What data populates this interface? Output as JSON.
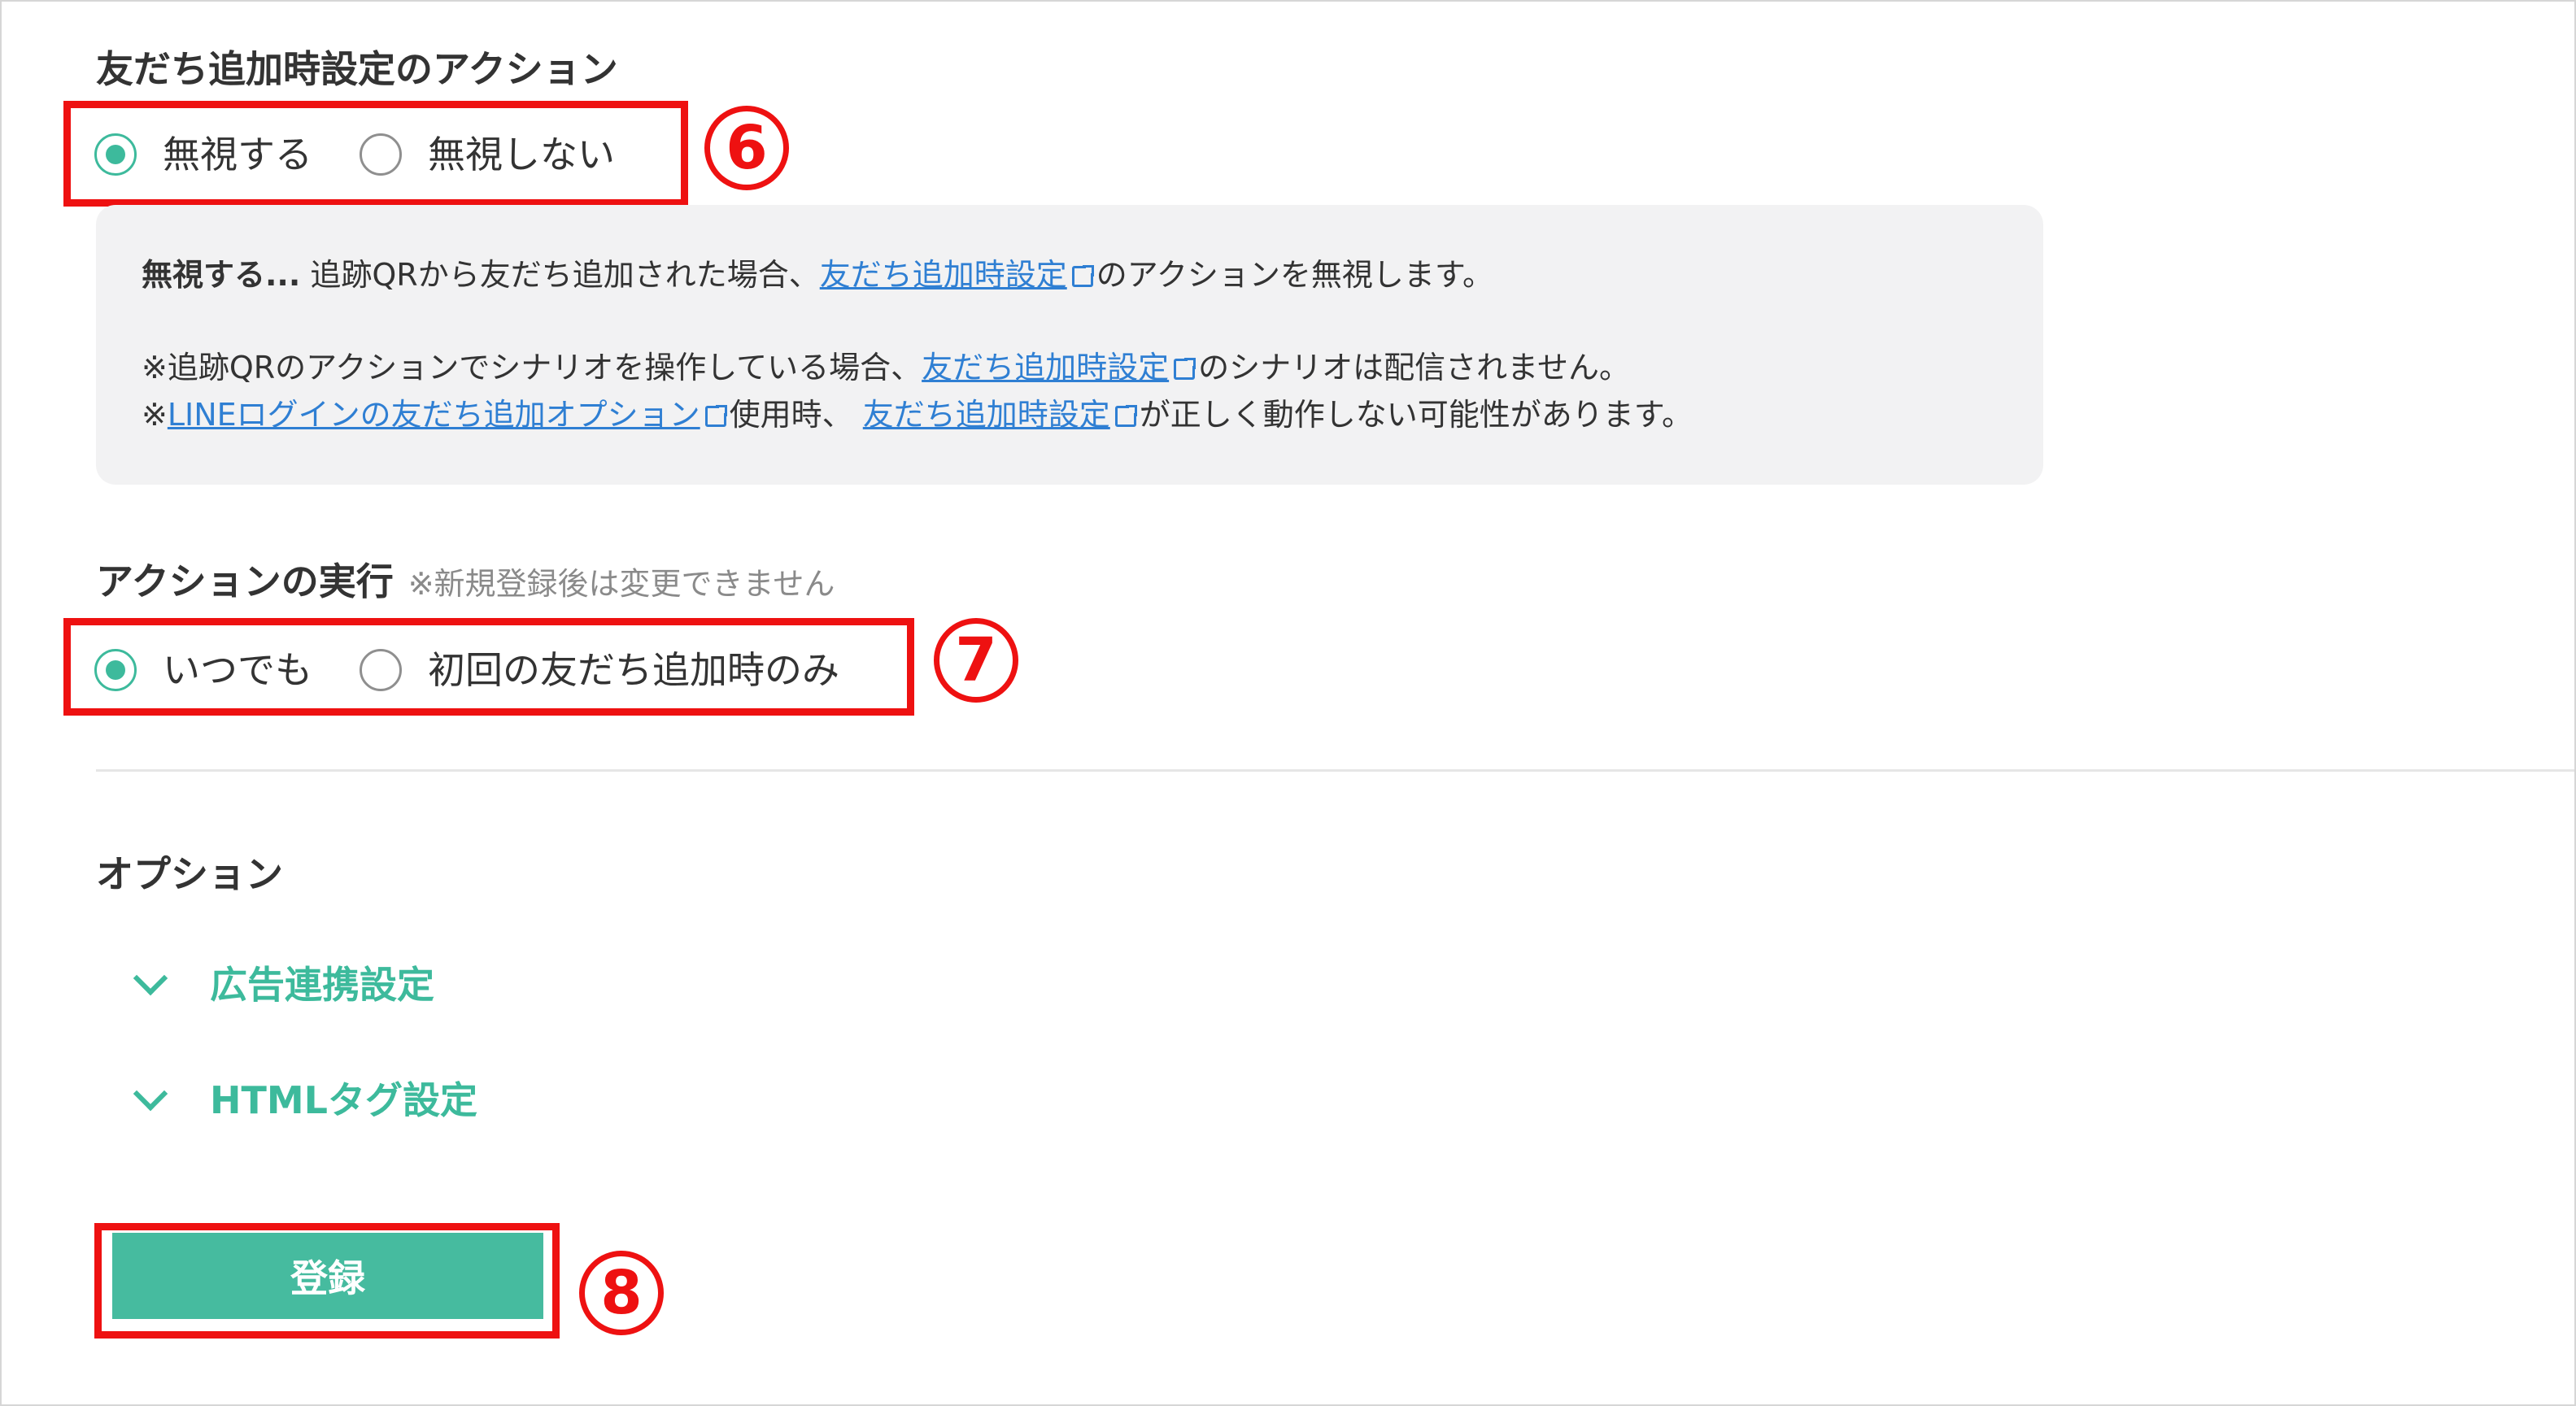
{
  "friend_add_action": {
    "title": "友だち追加時設定のアクション",
    "options": [
      {
        "label": "無視する",
        "checked": true
      },
      {
        "label": "無視しない",
        "checked": false
      }
    ],
    "annotation_number": "6"
  },
  "info": {
    "line1_bold": "無視する...",
    "line1_text_a": " 追跡QRから友だち追加された場合、",
    "line1_link": "友だち追加時設定",
    "line1_text_b": "のアクションを無視します。",
    "line2_text_a": "※追跡QRのアクションでシナリオを操作している場合、",
    "line2_link": "友だち追加時設定",
    "line2_text_b": "のシナリオは配信されません。",
    "line3_text_a": "※",
    "line3_link_a": "LINEログインの友だち追加オプション",
    "line3_text_b": "使用時、 ",
    "line3_link_b": "友だち追加時設定",
    "line3_text_c": "が正しく動作しない可能性があります。"
  },
  "action_execution": {
    "title": "アクションの実行",
    "note": "※新規登録後は変更できません",
    "options": [
      {
        "label": "いつでも",
        "checked": true
      },
      {
        "label": "初回の友だち追加時のみ",
        "checked": false
      }
    ],
    "annotation_number": "7"
  },
  "options_section": {
    "title": "オプション",
    "items": [
      {
        "label": "広告連携設定",
        "icon": "chevron-down-icon"
      },
      {
        "label": "HTMLタグ設定",
        "icon": "chevron-down-icon"
      }
    ]
  },
  "register": {
    "label": "登録",
    "annotation_number": "8"
  },
  "colors": {
    "accent": "#3dba9c",
    "button": "#46bb9f",
    "link": "#2f7fd3",
    "highlight": "#ee1111",
    "info_bg": "#f2f2f3"
  }
}
